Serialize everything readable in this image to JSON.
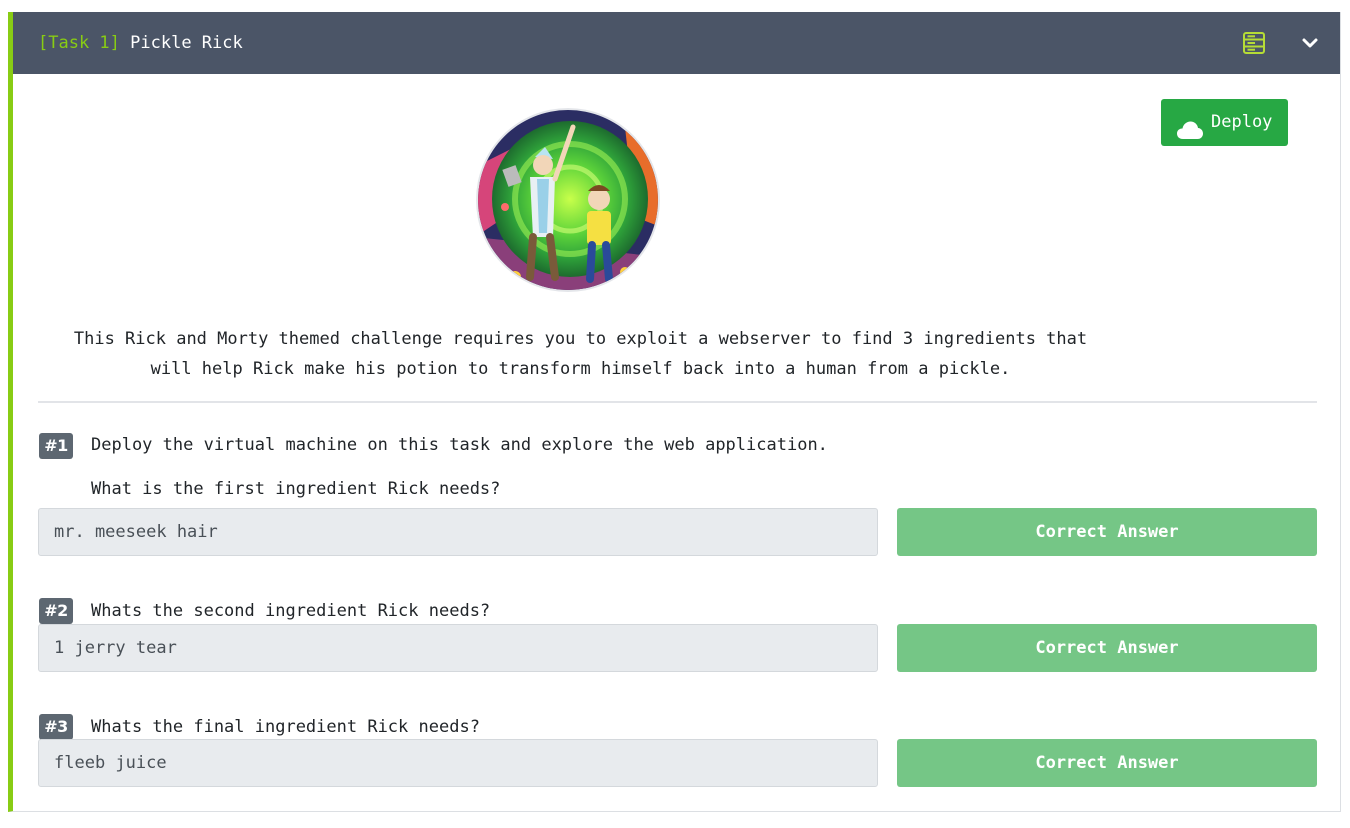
{
  "task": {
    "number_label": "[Task 1]",
    "name": "Pickle Rick",
    "header_icons": [
      "server-icon",
      "chevron-down-icon"
    ]
  },
  "deploy": {
    "label": "Deploy",
    "icon": "cloud-icon",
    "color": "#27a844"
  },
  "description": {
    "line1": "This Rick and Morty themed challenge requires you to exploit a webserver to find 3 ingredients that",
    "line2": "will help Rick make his potion to transform himself back into a human from a pickle."
  },
  "questions": [
    {
      "badge": "#1",
      "intro": "Deploy the virtual machine on this task and explore the web application.",
      "text": "What is the first ingredient Rick needs?",
      "answer": "mr. meeseek hair",
      "button": "Correct Answer"
    },
    {
      "badge": "#2",
      "text": "Whats the second ingredient Rick needs?",
      "answer": "1 jerry tear",
      "button": "Correct Answer"
    },
    {
      "badge": "#3",
      "text": "Whats the final ingredient Rick needs?",
      "answer": "fleeb juice",
      "button": "Correct Answer"
    }
  ],
  "colors": {
    "accent": "#88cc14",
    "header_bg": "#4b5567",
    "correct_button": "#75c686"
  }
}
